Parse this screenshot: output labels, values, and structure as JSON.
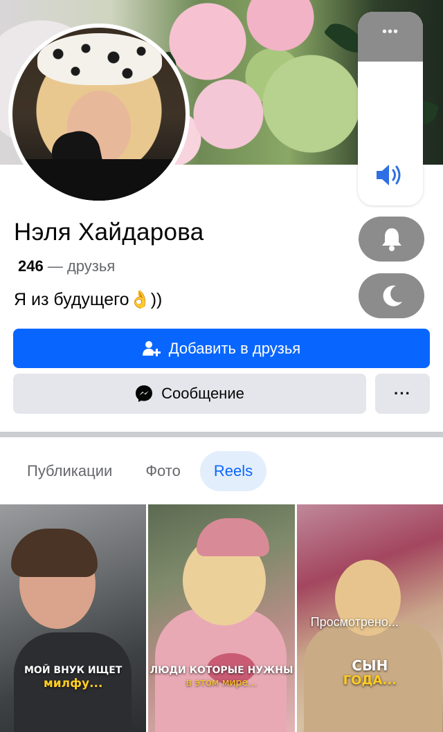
{
  "colors": {
    "primary_button": "#0866ff",
    "secondary_button": "#e4e6eb",
    "active_tab_bg": "#e3eefc",
    "active_tab_text": "#0866ff",
    "muted_text": "#65676b",
    "overlay_control": "#8c8c8c",
    "caption_yellow": "#ffcc22"
  },
  "profile": {
    "name": "Нэля Хайдарова",
    "friends_count": "246",
    "friends_label": "— друзья",
    "bio": "Я из будущего👌))"
  },
  "overlay_controls": {
    "more_icon": "more-dots-icon",
    "volume_icon": "speaker-icon",
    "bell_icon": "bell-icon",
    "moon_icon": "moon-icon"
  },
  "actions": {
    "add_friend_label": "Добавить в друзья",
    "add_friend_icon": "person-add-icon",
    "message_label": "Сообщение",
    "message_icon": "messenger-icon",
    "more_label": "···"
  },
  "tabs": [
    {
      "label": "Публикации",
      "active": false
    },
    {
      "label": "Фото",
      "active": false
    },
    {
      "label": "Reels",
      "active": true
    }
  ],
  "reels": [
    {
      "caption_line1": "МОЙ ВНУК ИЩЕТ",
      "caption_line2": "милфу..."
    },
    {
      "caption_line1": "ЛЮДИ КОТОРЫЕ НУЖНЫ",
      "caption_line2": "в этом мире..."
    },
    {
      "overlay_text": "Просмотрено...",
      "caption_line1": "СЫН",
      "caption_line2": "ГОДА..."
    }
  ]
}
